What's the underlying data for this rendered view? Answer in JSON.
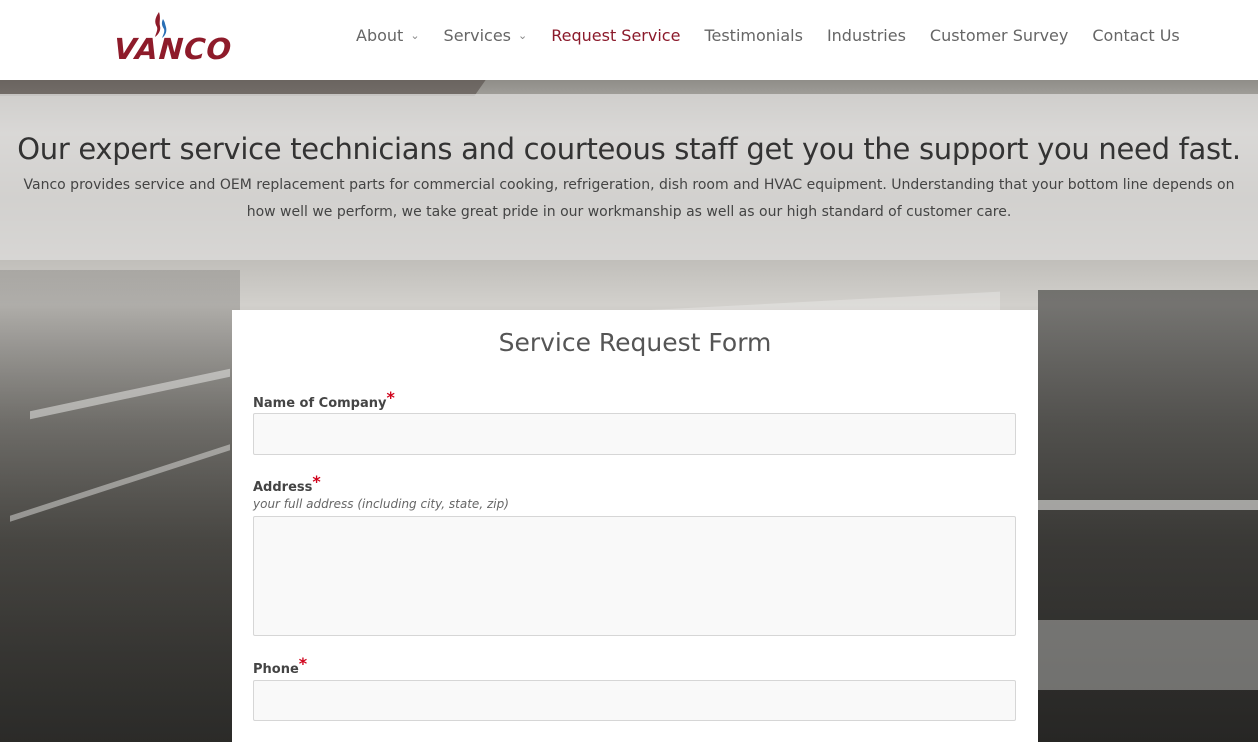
{
  "brand": {
    "logo_text": "VANCO",
    "logo_color": "#8e1b2a"
  },
  "nav": {
    "items": [
      {
        "label": "About",
        "has_dropdown": true,
        "active": false
      },
      {
        "label": "Services",
        "has_dropdown": true,
        "active": false
      },
      {
        "label": "Request Service",
        "has_dropdown": false,
        "active": true
      },
      {
        "label": "Testimonials",
        "has_dropdown": false,
        "active": false
      },
      {
        "label": "Industries",
        "has_dropdown": false,
        "active": false
      },
      {
        "label": "Customer Survey",
        "has_dropdown": false,
        "active": false
      },
      {
        "label": "Contact Us",
        "has_dropdown": false,
        "active": false
      }
    ],
    "active_color": "#8b1a2b"
  },
  "hero": {
    "headline": "Our expert service technicians and courteous staff get you the support you need fast.",
    "body": "Vanco provides service and OEM replacement parts for commercial cooking, refrigeration, dish room and HVAC equipment. Understanding that your bottom line depends on how well we perform, we take great pride in our workmanship as well as our high standard of customer care."
  },
  "form": {
    "title": "Service Request Form",
    "fields": [
      {
        "label": "Name of Company",
        "required": true,
        "hint": "",
        "value": "",
        "type": "text"
      },
      {
        "label": "Address",
        "required": true,
        "hint": "your full address (including city, state, zip)",
        "value": "",
        "type": "textarea"
      },
      {
        "label": "Phone",
        "required": true,
        "hint": "",
        "value": "",
        "type": "text"
      }
    ],
    "required_marker": "*",
    "required_color": "#d0021b"
  }
}
